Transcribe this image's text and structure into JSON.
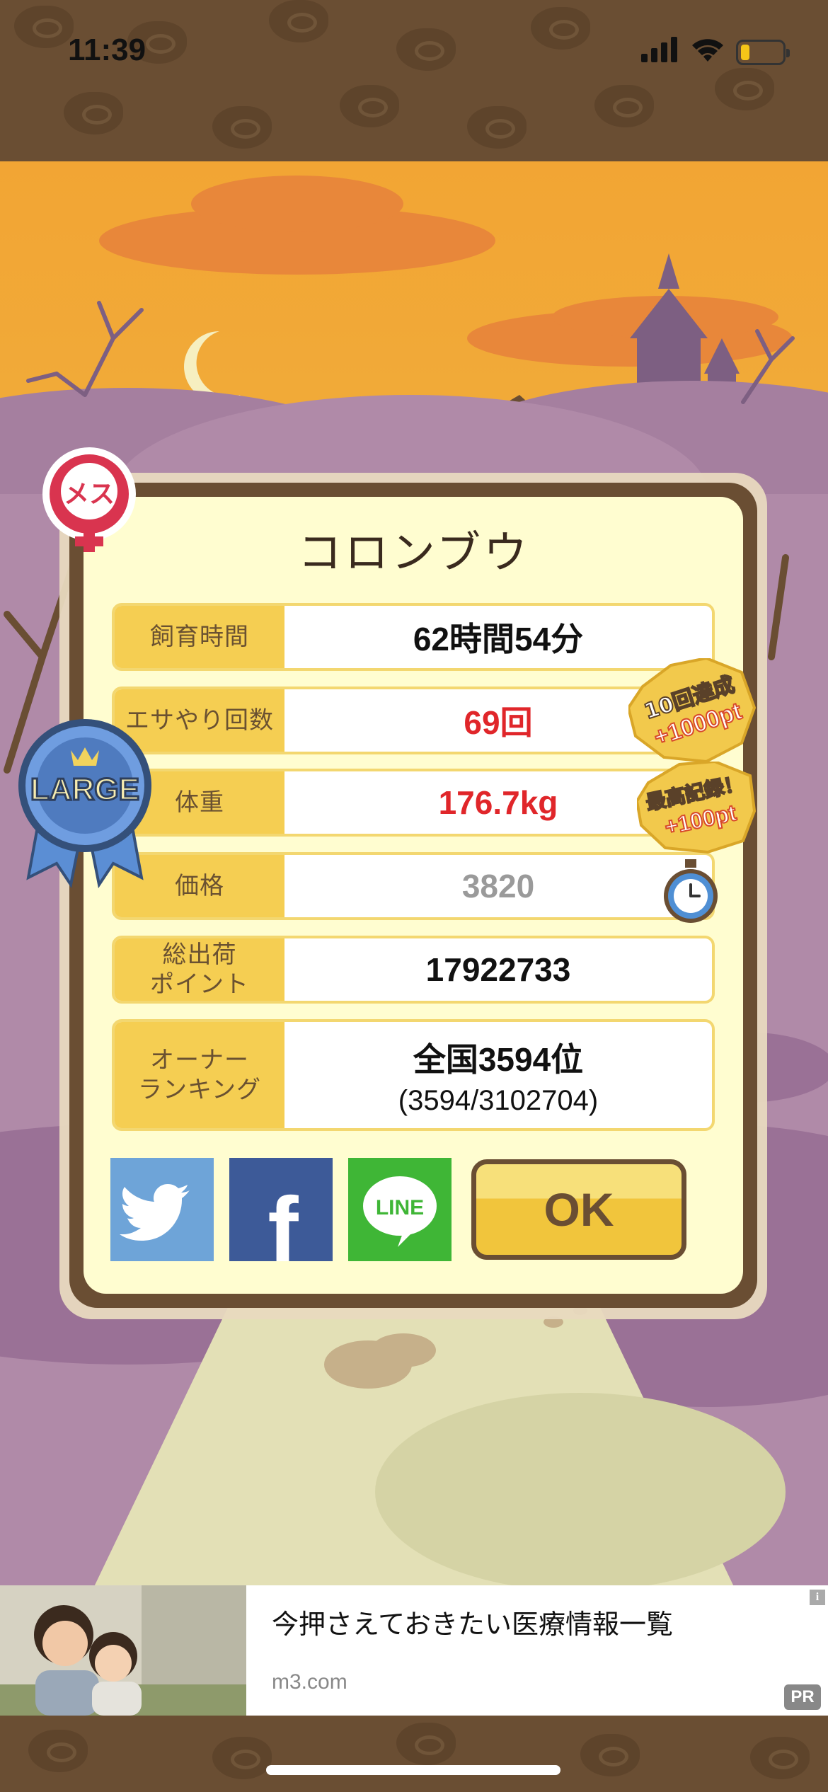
{
  "status_bar": {
    "time": "11:39"
  },
  "pet": {
    "name": "コロンブウ",
    "gender_badge": "メス",
    "size_badge": "LARGE"
  },
  "stats": [
    {
      "label": "飼育時間",
      "value": "62時間54分",
      "value_color": "#111111"
    },
    {
      "label": "エサやり回数",
      "value": "69回",
      "value_color": "#e0262a"
    },
    {
      "label": "体重",
      "value": "176.7kg",
      "value_color": "#e0262a"
    },
    {
      "label": "価格",
      "value": "3820",
      "value_color": "#9a9a9a"
    },
    {
      "label": "総出荷\nポイント",
      "value": "17922733",
      "value_color": "#111111"
    }
  ],
  "ranking": {
    "label": "オーナー\nランキング",
    "value": "全国3594位",
    "detail": "(3594/3102704)"
  },
  "bonuses": [
    {
      "line1": "10回達成",
      "line2": "+1000pt"
    },
    {
      "line1": "最高記録！",
      "line2": "+100pt"
    }
  ],
  "share": [
    {
      "icon": "twitter-icon"
    },
    {
      "icon": "facebook-icon",
      "glyph": "f"
    },
    {
      "icon": "line-icon",
      "glyph": "LINE"
    }
  ],
  "ok_button": {
    "label": "OK"
  },
  "ad": {
    "title": "今押さえておきたい医療情報一覧",
    "domain": "m3.com",
    "pr_badge": "PR",
    "info_glyph": "i"
  },
  "colors": {
    "accent_yellow": "#f5ce52",
    "frame_brown": "#6a4e33",
    "panel_cream": "#fffdd0",
    "red_value": "#e0262a"
  }
}
